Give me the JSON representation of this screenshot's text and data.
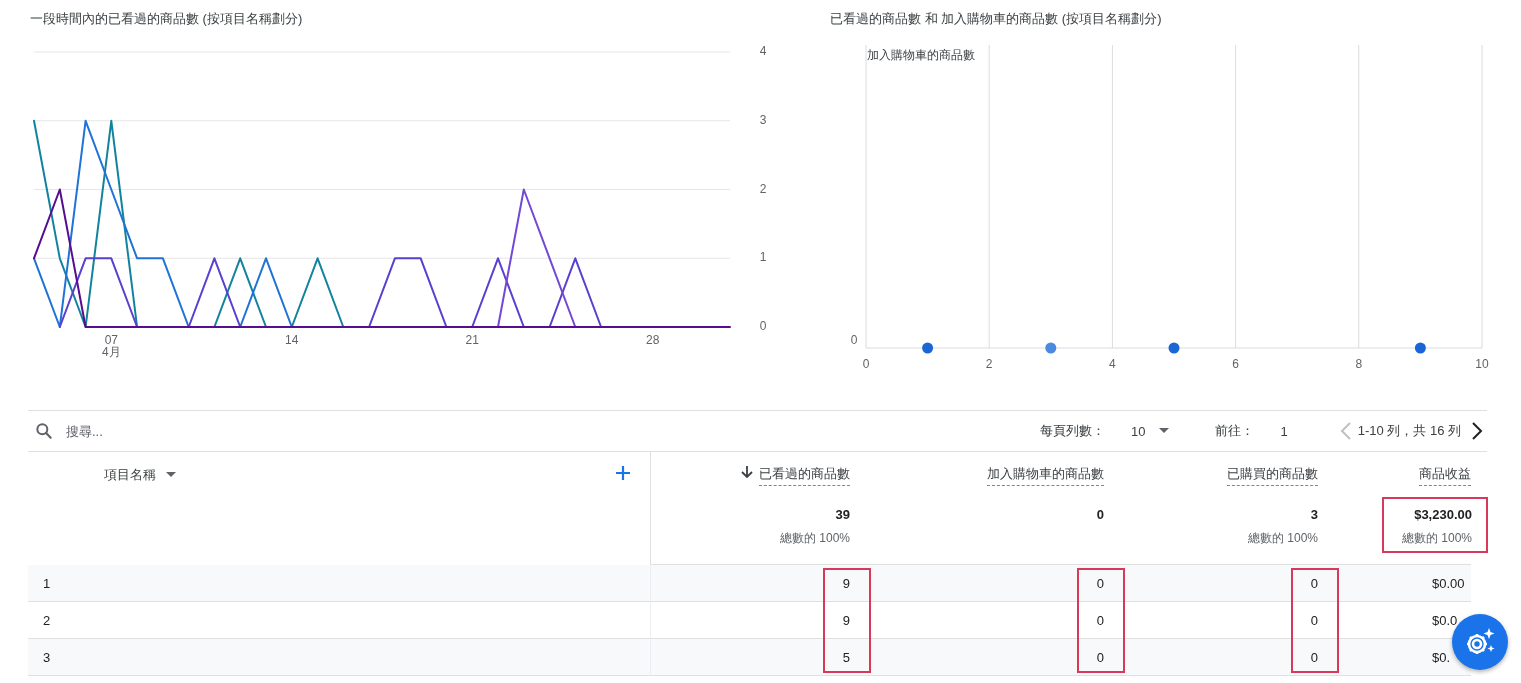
{
  "charts": [
    {
      "title": "一段時間內的已看過的商品數 (按項目名稱劃分)",
      "x_sublabel": "4月",
      "chart_data": {
        "type": "line",
        "grid": true,
        "xlim": [
          4,
          31
        ],
        "x": [
          4,
          5,
          6,
          7,
          8,
          9,
          10,
          11,
          12,
          13,
          14,
          15,
          16,
          17,
          18,
          19,
          20,
          21,
          22,
          23,
          24,
          25,
          26,
          27,
          28,
          29,
          30,
          31
        ],
        "xticks": [
          {
            "value": 7,
            "label": "07"
          },
          {
            "value": 14,
            "label": "14"
          },
          {
            "value": 21,
            "label": "21"
          },
          {
            "value": 28,
            "label": "28"
          }
        ],
        "ylim": [
          0,
          4
        ],
        "yticks": [
          0,
          1,
          2,
          3,
          4
        ],
        "series": [
          {
            "color": "#12839e",
            "values": [
              3,
              1,
              0,
              3,
              0,
              null,
              null,
              0,
              1,
              0,
              0,
              1,
              0,
              null,
              null,
              null,
              null,
              null,
              null,
              null,
              null,
              null,
              null,
              null,
              null,
              null,
              null,
              null
            ]
          },
          {
            "color": "#1f73d6",
            "values": [
              1,
              0,
              3,
              2,
              1,
              1,
              0,
              null,
              0,
              1,
              0,
              null,
              null,
              null,
              null,
              null,
              null,
              null,
              null,
              null,
              null,
              null,
              null,
              null,
              null,
              null,
              null,
              null
            ]
          },
          {
            "color": "#5a3fd1",
            "values": [
              null,
              0,
              1,
              1,
              0,
              null,
              0,
              1,
              0,
              null,
              null,
              null,
              null,
              0,
              1,
              1,
              0,
              0,
              1,
              0,
              0,
              1,
              0,
              null,
              null,
              null,
              null,
              null
            ]
          },
          {
            "color": "#7248d4",
            "values": [
              null,
              null,
              null,
              null,
              null,
              null,
              null,
              null,
              null,
              null,
              null,
              null,
              null,
              null,
              null,
              null,
              null,
              null,
              0,
              2,
              1,
              0,
              null,
              null,
              null,
              null,
              null,
              null
            ]
          },
          {
            "color": "#560d8f",
            "values": [
              1,
              2,
              0,
              0,
              0,
              0,
              0,
              0,
              0,
              0,
              0,
              0,
              0,
              0,
              0,
              0,
              0,
              0,
              0,
              0,
              0,
              0,
              0,
              0,
              0,
              0,
              0,
              0
            ]
          }
        ]
      }
    },
    {
      "title": "已看過的商品數 和 加入購物車的商品數 (按項目名稱劃分)",
      "y_axis_title": "加入購物車的商品數",
      "y_axis_label": "0",
      "x_axis_labels": [
        "0",
        "2",
        "4",
        "6",
        "8",
        "10"
      ]
    }
  ],
  "table": {
    "search": {
      "placeholder": "搜尋..."
    },
    "pager": {
      "rows_per_page_label": "每頁列數：",
      "rows_per_page": "10",
      "goto_label": "前往：",
      "goto_page": "1",
      "range": "1-10 列，共 16 列",
      "prev": {
        "disabled": true
      },
      "next": {
        "disabled": false
      }
    },
    "name_column": {
      "label": "項目名稱"
    },
    "columns": [
      {
        "label": "已看過的商品數",
        "sorted": true,
        "total": "39",
        "total_share": "總數的 100%",
        "total_highlighted": false,
        "rows_highlighted": true
      },
      {
        "label": "加入購物車的商品數",
        "sorted": false,
        "total": "0",
        "total_highlighted": false,
        "rows_highlighted": true
      },
      {
        "label": "已購買的商品數",
        "sorted": false,
        "total": "3",
        "total_share": "總數的 100%",
        "total_highlighted": false,
        "rows_highlighted": true
      },
      {
        "label": "商品收益",
        "sorted": false,
        "total": "$3,230.00",
        "total_share": "總數的 100%",
        "total_highlighted": true,
        "rows_highlighted": false
      }
    ],
    "rows": [
      {
        "index": "1",
        "values": [
          "9",
          "0",
          "0",
          "$0.00"
        ]
      },
      {
        "index": "2",
        "values": [
          "9",
          "0",
          "0",
          "$0.0"
        ]
      },
      {
        "index": "3",
        "values": [
          "5",
          "0",
          "0",
          "$0."
        ]
      }
    ]
  }
}
